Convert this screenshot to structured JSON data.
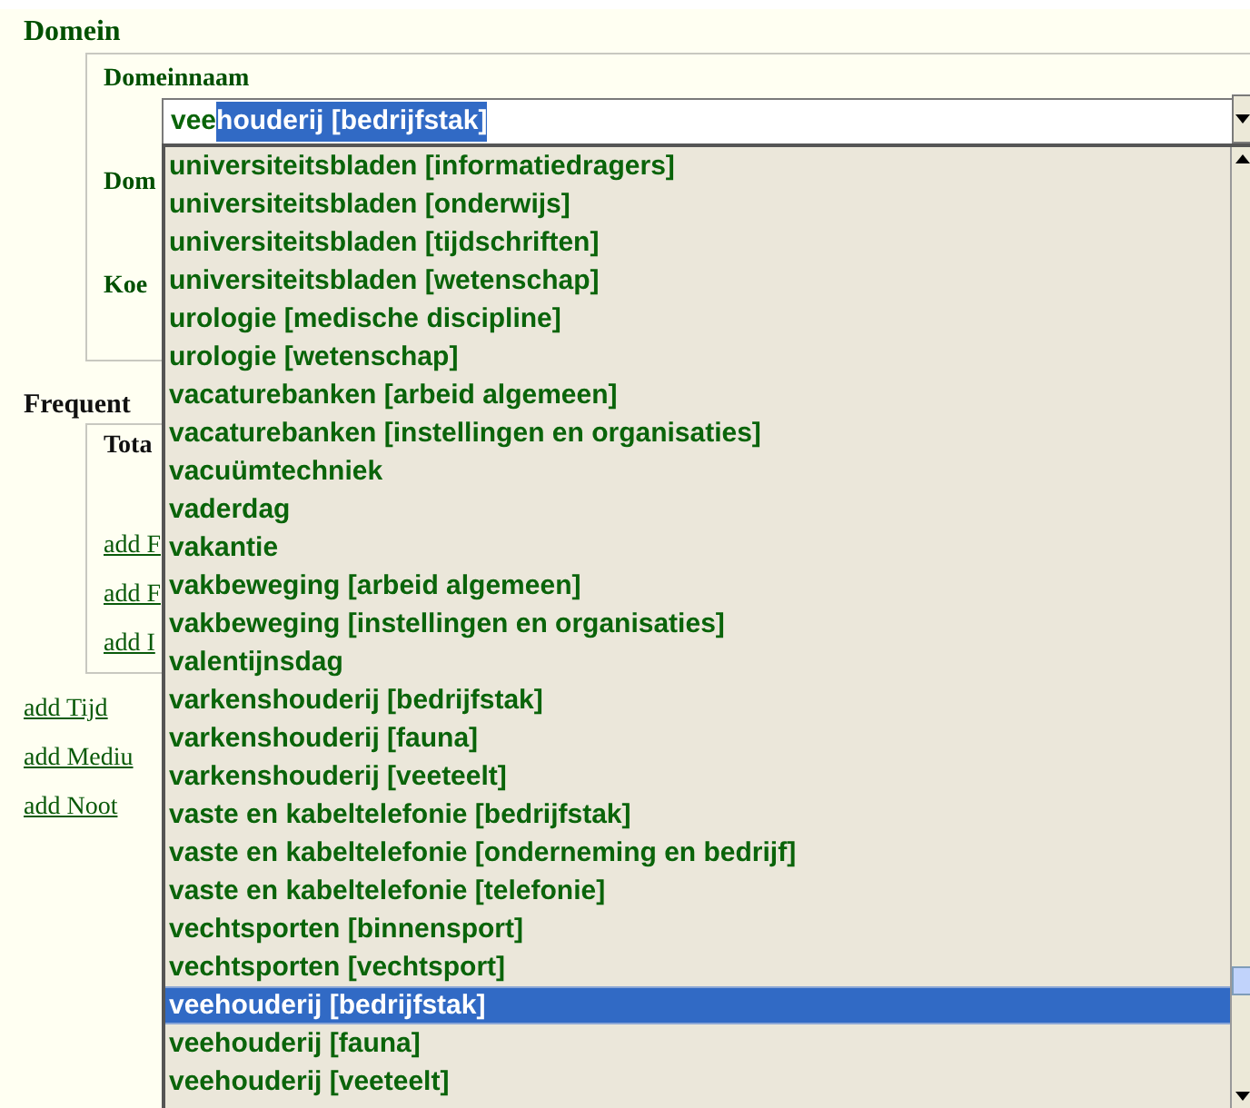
{
  "domain_section": {
    "title": "Domein",
    "labels": [
      "Domeinnaam",
      "Dom",
      "Koe"
    ],
    "field": {
      "typed": "vee",
      "autocompleted": "houderij [bedrijfstak]"
    }
  },
  "dropdown": {
    "items": [
      {
        "label": "universiteitsbladen [informatiedragers]",
        "selected": false
      },
      {
        "label": "universiteitsbladen [onderwijs]",
        "selected": false
      },
      {
        "label": "universiteitsbladen [tijdschriften]",
        "selected": false
      },
      {
        "label": "universiteitsbladen [wetenschap]",
        "selected": false
      },
      {
        "label": "urologie [medische discipline]",
        "selected": false
      },
      {
        "label": "urologie [wetenschap]",
        "selected": false
      },
      {
        "label": "vacaturebanken [arbeid algemeen]",
        "selected": false
      },
      {
        "label": "vacaturebanken [instellingen en organisaties]",
        "selected": false
      },
      {
        "label": "vacuümtechniek",
        "selected": false
      },
      {
        "label": "vaderdag",
        "selected": false
      },
      {
        "label": "vakantie",
        "selected": false
      },
      {
        "label": "vakbeweging [arbeid algemeen]",
        "selected": false
      },
      {
        "label": "vakbeweging [instellingen en organisaties]",
        "selected": false
      },
      {
        "label": "valentijnsdag",
        "selected": false
      },
      {
        "label": "varkenshouderij [bedrijfstak]",
        "selected": false
      },
      {
        "label": "varkenshouderij [fauna]",
        "selected": false
      },
      {
        "label": "varkenshouderij [veeteelt]",
        "selected": false
      },
      {
        "label": "vaste en kabeltelefonie [bedrijfstak]",
        "selected": false
      },
      {
        "label": "vaste en kabeltelefonie [onderneming en bedrijf]",
        "selected": false
      },
      {
        "label": "vaste en kabeltelefonie [telefonie]",
        "selected": false
      },
      {
        "label": "vechtsporten [binnensport]",
        "selected": false
      },
      {
        "label": "vechtsporten [vechtsport]",
        "selected": false
      },
      {
        "label": "veehouderij [bedrijfstak]",
        "selected": true
      },
      {
        "label": "veehouderij [fauna]",
        "selected": false
      },
      {
        "label": "veehouderij [veeteelt]",
        "selected": false
      }
    ]
  },
  "frequency_section": {
    "title": "Frequent",
    "label": "Tota",
    "links": [
      "add F",
      "add F",
      "add I"
    ]
  },
  "links": [
    "add Tijd",
    "add Mediu",
    "add Noot"
  ]
}
